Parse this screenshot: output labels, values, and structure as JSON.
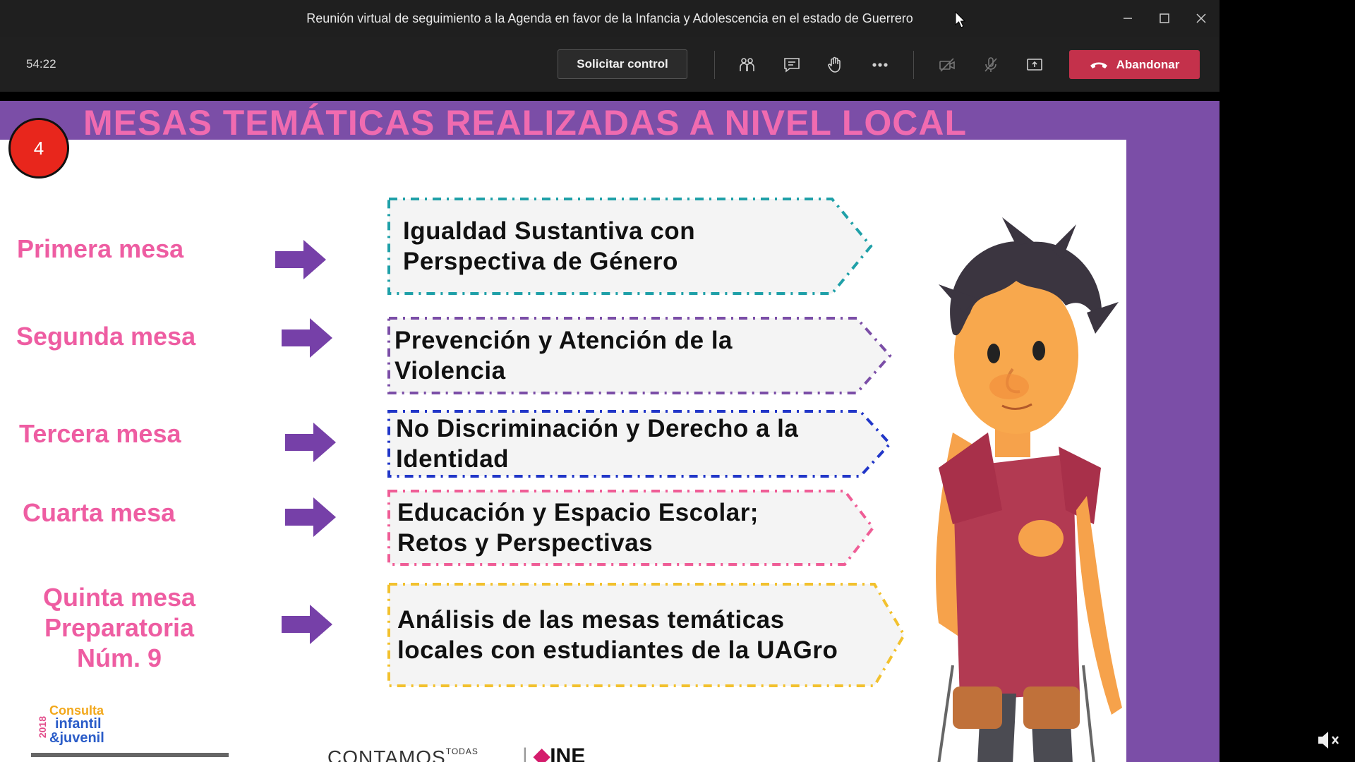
{
  "window": {
    "title": "Reunión virtual de seguimiento a la Agenda en favor de la Infancia y Adolescencia en el estado de Guerrero"
  },
  "toolbar": {
    "timer": "54:22",
    "request_control_label": "Solicitar control",
    "leave_label": "Abandonar",
    "icons": [
      "participants-icon",
      "chat-icon",
      "raise-hand-icon",
      "more-icon",
      "camera-off-icon",
      "mic-off-icon",
      "share-icon"
    ],
    "leave_color": "#c4314b"
  },
  "slide": {
    "number": "4",
    "title": "MESAS TEMÁTICAS REALIZADAS A NIVEL LOCAL",
    "title_color": "#f06bb0",
    "accent_color": "#7b4ea7",
    "mesas": [
      {
        "label": "Primera mesa",
        "topic": "Igualdad Sustantiva con Perspectiva de Género",
        "border_color": "#1fa0a8"
      },
      {
        "label": "Segunda mesa",
        "topic": "Prevención y Atención de la Violencia",
        "border_color": "#7b4ea7"
      },
      {
        "label": "Tercera mesa",
        "topic": "No Discriminación y Derecho a la Identidad",
        "border_color": "#2136c8"
      },
      {
        "label": "Cuarta mesa",
        "topic": "Educación y Espacio Escolar; Retos y Perspectivas",
        "border_color": "#ef5d96"
      },
      {
        "label": "Quinta mesa Preparatoria Núm. 9",
        "topic": "Análisis de las mesas temáticas locales con estudiantes de la UAGro",
        "border_color": "#f2c12e"
      }
    ],
    "footer": {
      "consulta_year": "2018",
      "consulta_line1": "Consulta",
      "consulta_line2": "infantil",
      "consulta_line3": "&juvenil",
      "contamos": "CONTAMOS",
      "contamos_small": "TODAS",
      "ine": "INE"
    }
  }
}
